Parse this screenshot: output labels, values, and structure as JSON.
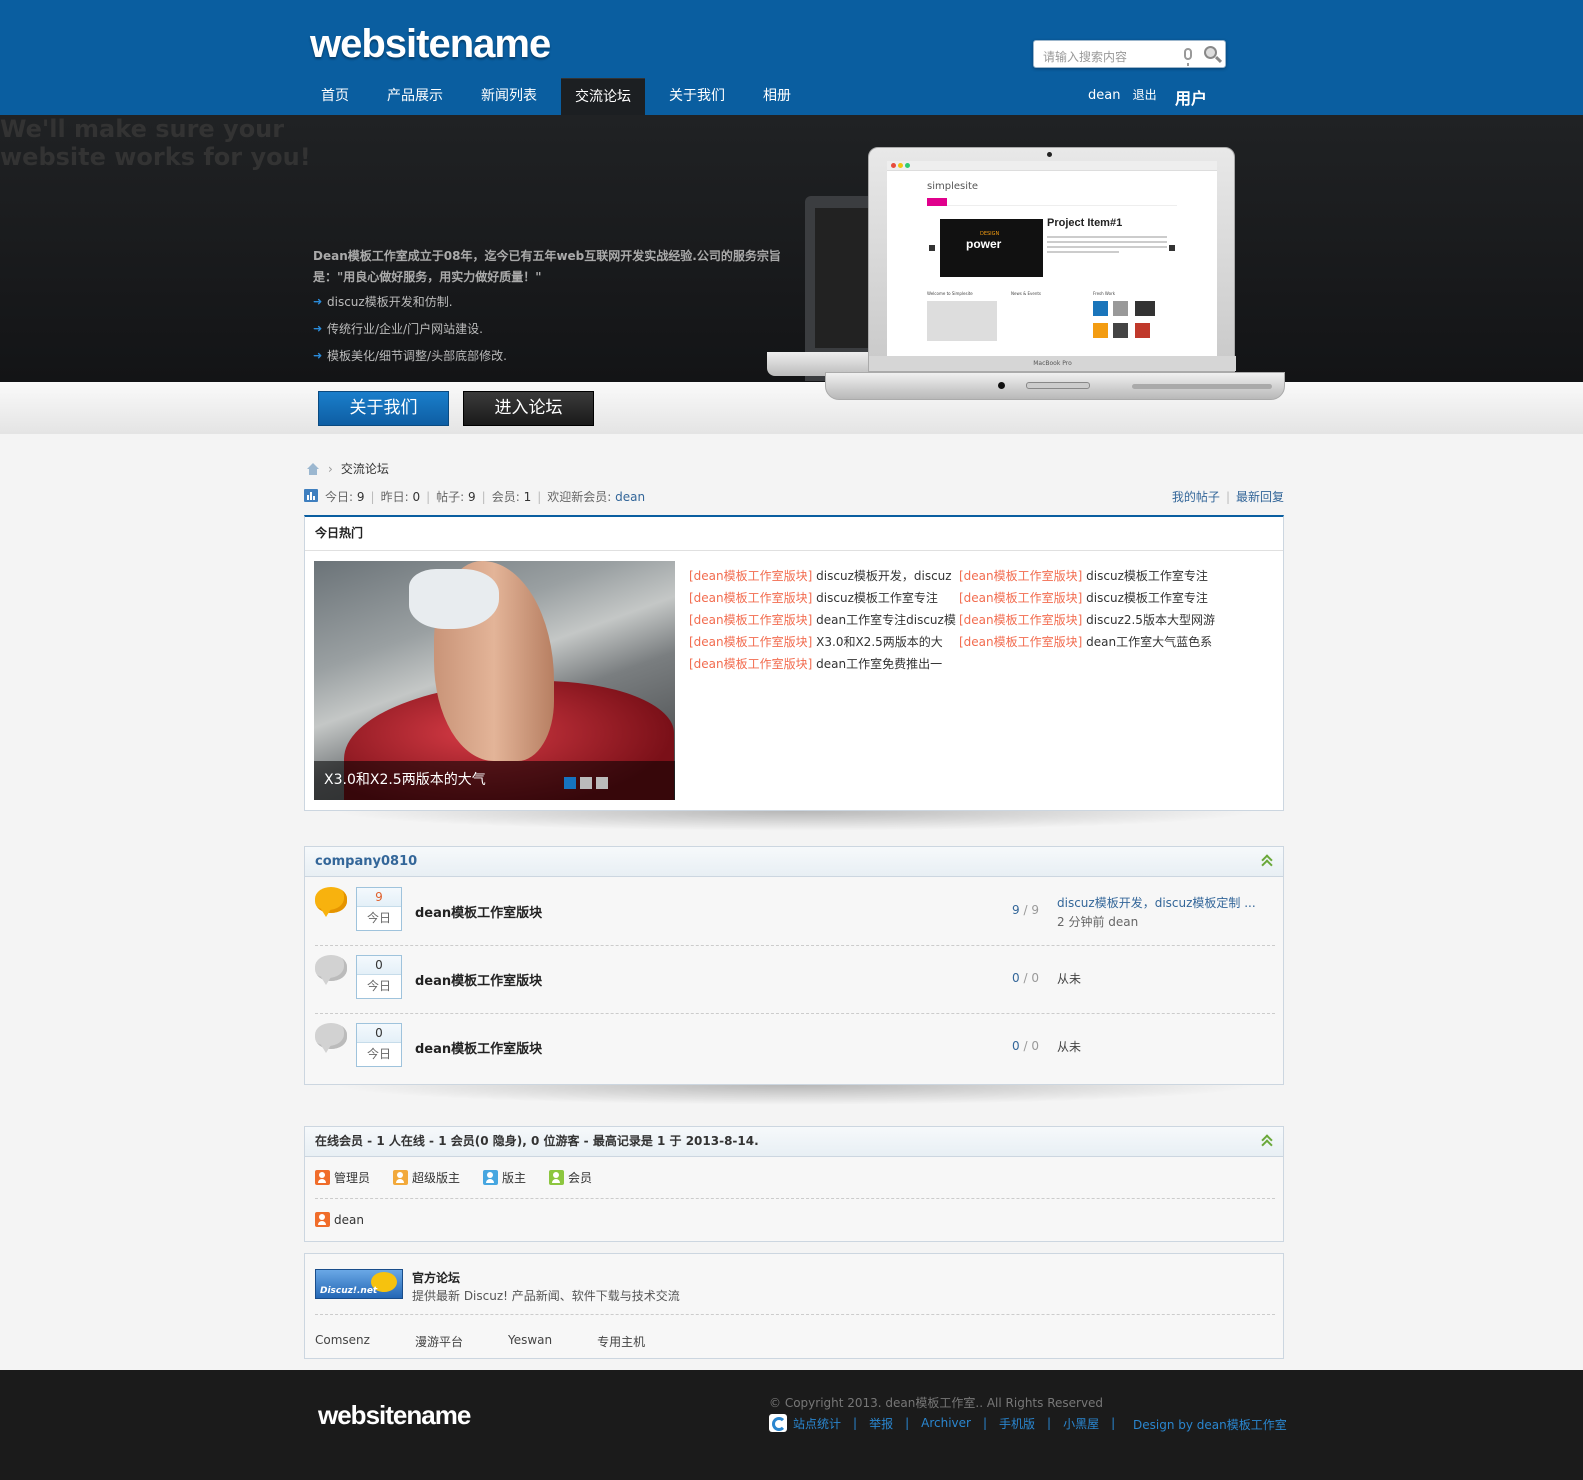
{
  "header": {
    "logo": "websitename",
    "search_placeholder": "请输入搜索内容",
    "nav": [
      "首页",
      "产品展示",
      "新闻列表",
      "交流论坛",
      "关于我们",
      "相册"
    ],
    "active_nav": "交流论坛",
    "username": "dean",
    "logout": "退出",
    "user_link": "用户"
  },
  "hero": {
    "line1": "We'll make sure your",
    "line2_bold": "website works",
    "line2_rest": " for you!",
    "desc": "Dean模板工作室成立于08年，迄今已有五年web互联网开发实战经验.公司的服务宗旨是：\"用良心做好服务，用实力做好质量！\"",
    "bullets": [
      "discuz模板开发和仿制.",
      "传统行业/企业/门户网站建设.",
      "模板美化/细节调整/头部底部修改."
    ],
    "btn_about": "关于我们",
    "btn_forum": "进入论坛",
    "screen": {
      "site": "simplesite",
      "project": "Project Item#1",
      "slide_small": "DESIGN",
      "slide_big": "power",
      "sec1": "Welcome to Simplesite",
      "sec2": "News & Events",
      "sec3": "Fresh Work",
      "brand": "MacBook Pro"
    }
  },
  "breadcrumb": {
    "current": "交流论坛"
  },
  "stats": {
    "today_label": "今日:",
    "today": "9",
    "yesterday_label": "昨日:",
    "yesterday": "0",
    "posts_label": "帖子:",
    "posts": "9",
    "members_label": "会员:",
    "members": "1",
    "welcome_label": "欢迎新会员:",
    "new_member": "dean",
    "my_posts": "我的帖子",
    "latest_replies": "最新回复"
  },
  "hot": {
    "title": "今日热门",
    "slide_caption": "X3.0和X2.5两版本的大气",
    "col1": [
      {
        "tag": "[dean模板工作室版块]",
        "title": "discuz模板开发，discuz"
      },
      {
        "tag": "[dean模板工作室版块]",
        "title": "discuz模板工作室专注"
      },
      {
        "tag": "[dean模板工作室版块]",
        "title": "dean工作室专注discuz模"
      },
      {
        "tag": "[dean模板工作室版块]",
        "title": "X3.0和X2.5两版本的大"
      },
      {
        "tag": "[dean模板工作室版块]",
        "title": "dean工作室免费推出一"
      }
    ],
    "col2": [
      {
        "tag": "[dean模板工作室版块]",
        "title": "discuz模板工作室专注"
      },
      {
        "tag": "[dean模板工作室版块]",
        "title": "discuz模板工作室专注"
      },
      {
        "tag": "[dean模板工作室版块]",
        "title": "discuz2.5版本大型网游"
      },
      {
        "tag": "[dean模板工作室版块]",
        "title": "dean工作室大气蓝色系"
      }
    ]
  },
  "forum": {
    "title": "company0810",
    "rows": [
      {
        "count": "9",
        "count_label": "今日",
        "name": "dean模板工作室版块",
        "threads": "9",
        "posts": "9",
        "last_title": "discuz模板开发，discuz模板定制 ...",
        "last_meta": "2 分钟前 dean",
        "active": true
      },
      {
        "count": "0",
        "count_label": "今日",
        "name": "dean模板工作室版块",
        "threads": "0",
        "posts": "0",
        "last_title": "",
        "last_meta": "从未",
        "active": false
      },
      {
        "count": "0",
        "count_label": "今日",
        "name": "dean模板工作室版块",
        "threads": "0",
        "posts": "0",
        "last_title": "",
        "last_meta": "从未",
        "active": false
      }
    ]
  },
  "online": {
    "title": "在线会员 - 1 人在线 - 1 会员(0 隐身), 0 位游客 - 最高记录是 1 于 2013-8-14.",
    "legend": [
      {
        "label": "管理员",
        "color": "#f06d2b"
      },
      {
        "label": "超级版主",
        "color": "#f2a93b"
      },
      {
        "label": "版主",
        "color": "#46a6e0"
      },
      {
        "label": "会员",
        "color": "#8cc63f"
      }
    ],
    "member": "dean"
  },
  "links": {
    "logo_text": "Discuz!.net",
    "title": "官方论坛",
    "desc": "提供最新 Discuz! 产品新闻、软件下载与技术交流",
    "items": [
      "Comsenz",
      "漫游平台",
      "Yeswan",
      "专用主机"
    ]
  },
  "footer": {
    "logo": "websitename",
    "copyright": "© Copyright 2013. dean模板工作室.. All Rights Reserved",
    "links": [
      "站点统计",
      "举报",
      "Archiver",
      "手机版",
      "小黑屋"
    ],
    "design": "Design by dean模板工作室"
  }
}
